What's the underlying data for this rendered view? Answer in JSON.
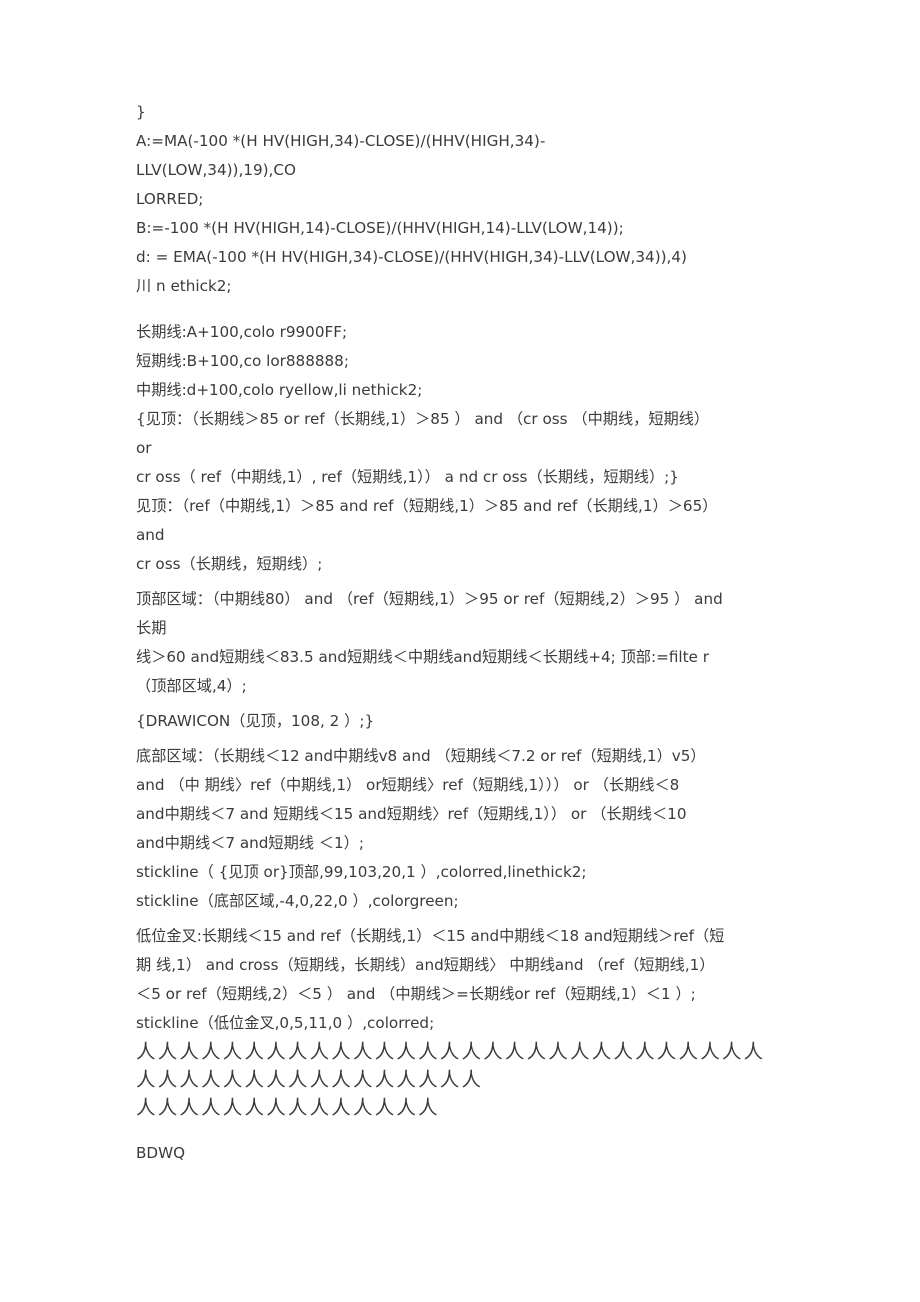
{
  "document": {
    "page_background": "#ffffff",
    "text_color": "#3b3b3b",
    "blocks": [
      {
        "id": "block-formula-header",
        "name": "code-block-formula-definitions",
        "lines": [
          "}",
          "A:=MA(-100 *(H HV(HIGH,34)-CLOSE)/(HHV(HIGH,34)-",
          "LLV(LOW,34)),19),CO",
          "LORRED;",
          "B:=-100 *(H HV(HIGH,14)-CLOSE)/(HHV(HIGH,14)-LLV(LOW,14));",
          "d: = EMA(-100 *(H HV(HIGH,34)-CLOSE)/(HHV(HIGH,34)-LLV(LOW,34)),4)",
          "川 n ethick2;"
        ]
      },
      {
        "id": "block-lines-def",
        "name": "code-block-line-definitions",
        "lines": [
          "长期线:A+100,colo r9900FF;",
          "短期线:B+100,co lor888888;",
          "中期线:d+100,colo ryellow,li nethick2;"
        ]
      },
      {
        "id": "block-jianding-comment",
        "name": "code-block-jianding-commented",
        "lines": [
          "{见顶：（长期线＞85 or ref（长期线,1）＞85 ） and （cr oss （中期线，短期线）",
          "or",
          "cr oss（ ref（中期线,1）, ref（短期线,1）） a nd cr oss（长期线，短期线）;}"
        ]
      },
      {
        "id": "block-jianding",
        "name": "code-block-jianding",
        "lines": [
          "见顶：（ref（中期线,1）＞85 and ref（短期线,1）＞85 and ref（长期线,1）＞65）",
          "and",
          "cr oss（长期线，短期线）;"
        ]
      },
      {
        "id": "block-top-zone",
        "name": "code-block-top-zone",
        "lines": [
          "顶部区域：（中期线80） and （ref（短期线,1）＞95 or ref（短期线,2）＞95 ） and",
          "长期",
          "线＞60 and短期线＜83.5 and短期线＜中期线and短期线＜长期线+4; 顶部:=filte r",
          "（顶部区域,4）;"
        ]
      },
      {
        "id": "block-drawicon",
        "name": "code-block-drawicon",
        "lines": [
          "{DRAWICON（见顶，108, 2 ）;}"
        ]
      },
      {
        "id": "block-bottom-zone",
        "name": "code-block-bottom-zone",
        "lines": [
          "底部区域：（长期线＜12 and中期线v8 and （短期线＜7.2 or ref（短期线,1）v5）",
          "and （中 期线〉ref（中期线,1） or短期线〉ref（短期线,1））） or （长期线＜8",
          "and中期线＜7 and 短期线＜15 and短期线〉ref（短期线,1）） or （长期线＜10",
          "and中期线＜7 and短期线 ＜1）;",
          "stickline（ {见顶 or}顶部,99,103,20,1 ）,colorred,linethick2;",
          "stickline（底部区域,-4,0,22,0 ）,colorgreen;"
        ]
      },
      {
        "id": "block-low-cross",
        "name": "code-block-low-golden-cross",
        "lines": [
          "低位金叉:长期线＜15 and ref（长期线,1）＜15 and中期线＜18 and短期线＞ref（短",
          "期 线,1） and cross（短期线，长期线）and短期线〉 中期线and （ref（短期线,1）",
          "＜5 or ref（短期线,2）＜5 ） and （中期线＞=长期线or ref（短期线,1）＜1 ）;",
          "stickline（低位金叉,0,5,11,0 ）,colorred;"
        ]
      }
    ],
    "ren_rows": [
      "人人人人人人人人人人人人人人人人人人人人人人人人人人人人人",
      "人人人人人人人人人人人人人人人人",
      "人人人人人人人人人人人人人人"
    ],
    "footer_text": "BDWQ"
  }
}
